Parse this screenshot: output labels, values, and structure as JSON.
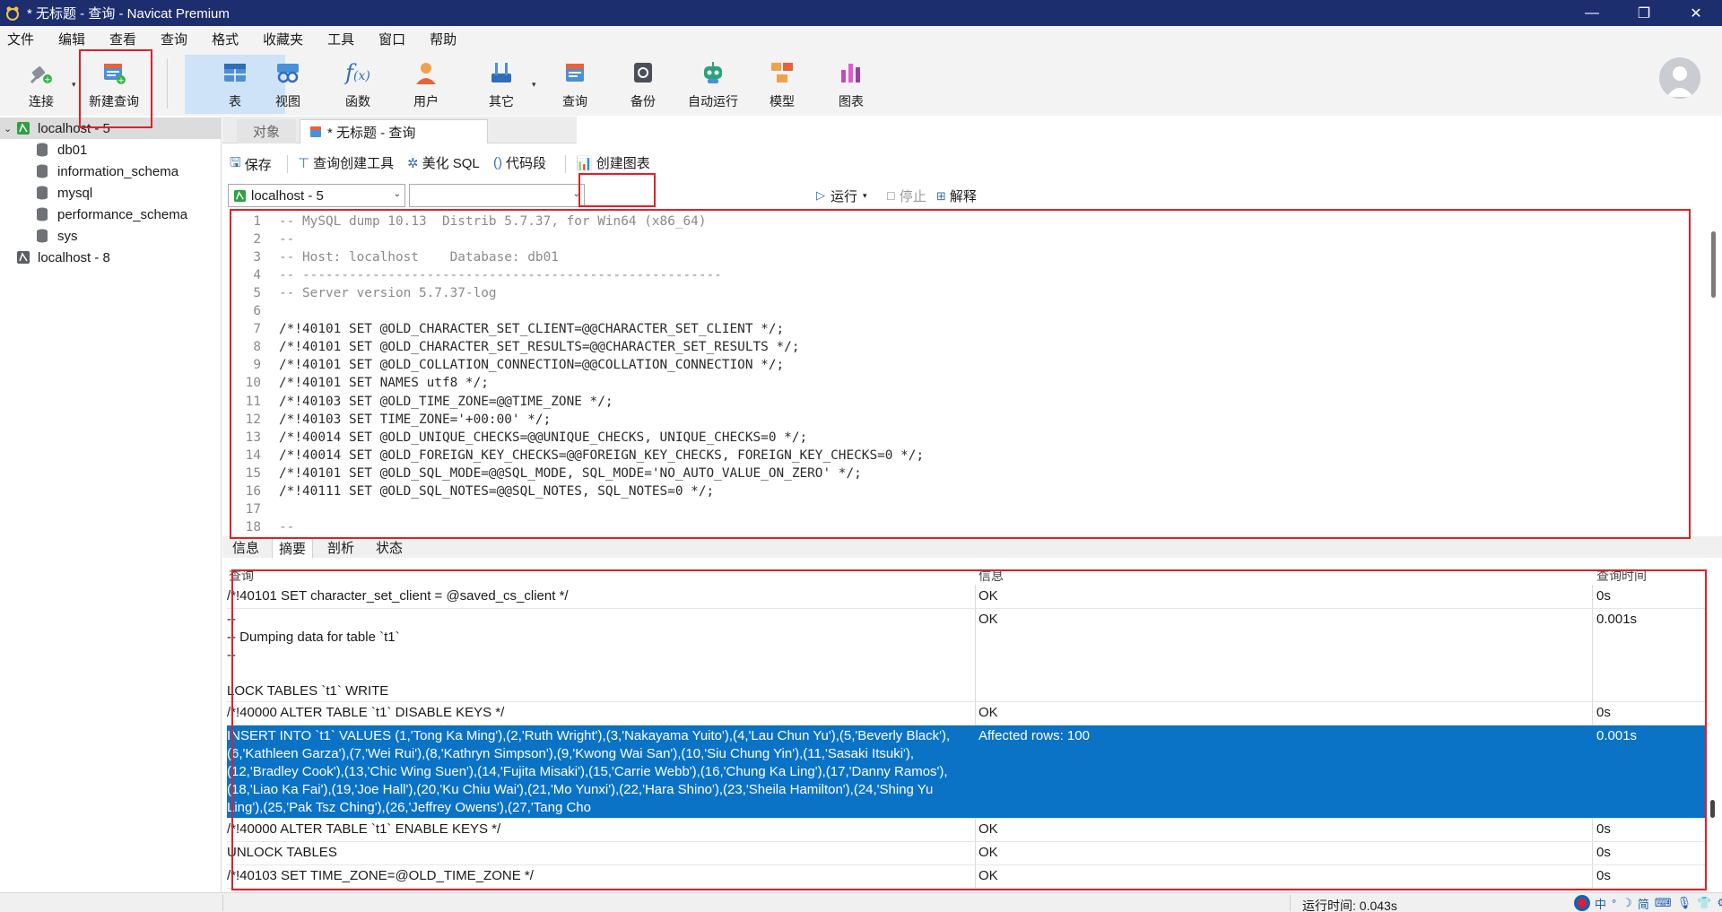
{
  "window": {
    "title": "* 无标题 - 查询 - Navicat Premium",
    "buttons": [
      "—",
      "❐",
      "✕"
    ]
  },
  "menu": [
    "文件",
    "编辑",
    "查看",
    "查询",
    "格式",
    "收藏夹",
    "工具",
    "窗口",
    "帮助"
  ],
  "toolbar": {
    "connect": "连接",
    "new_query": "新建查询",
    "table": "表",
    "view": "视图",
    "function": "函数",
    "user": "用户",
    "other": "其它",
    "query": "查询",
    "backup": "备份",
    "automation": "自动运行",
    "model": "模型",
    "chart": "图表"
  },
  "sidebar": {
    "connections": [
      {
        "name": "localhost - 5",
        "expanded": true,
        "databases": [
          "db01",
          "information_schema",
          "mysql",
          "performance_schema",
          "sys"
        ]
      },
      {
        "name": "localhost - 8",
        "expanded": false
      }
    ]
  },
  "tabs": {
    "objects": "对象",
    "query": "* 无标题 - 查询"
  },
  "query_toolbar": {
    "save": "保存",
    "builder": "查询创建工具",
    "beautify": "美化 SQL",
    "snippet": "代码段",
    "create_chart": "创建图表",
    "connection_select": "localhost - 5",
    "database_select": "",
    "run": "运行",
    "stop": "停止",
    "explain": "解释"
  },
  "editor": {
    "lines": [
      {
        "n": "1",
        "text": "-- MySQL dump 10.13  Distrib 5.7.37, for Win64 (x86_64)",
        "comment": true
      },
      {
        "n": "2",
        "text": "--",
        "comment": true
      },
      {
        "n": "3",
        "text": "-- Host: localhost    Database: db01",
        "comment": true
      },
      {
        "n": "4",
        "text": "-- ------------------------------------------------------",
        "comment": true
      },
      {
        "n": "5",
        "text": "-- Server version 5.7.37-log",
        "comment": true
      },
      {
        "n": "6",
        "text": "",
        "comment": false
      },
      {
        "n": "7",
        "text": "/*!40101 SET @OLD_CHARACTER_SET_CLIENT=@@CHARACTER_SET_CLIENT */;",
        "comment": false
      },
      {
        "n": "8",
        "text": "/*!40101 SET @OLD_CHARACTER_SET_RESULTS=@@CHARACTER_SET_RESULTS */;",
        "comment": false
      },
      {
        "n": "9",
        "text": "/*!40101 SET @OLD_COLLATION_CONNECTION=@@COLLATION_CONNECTION */;",
        "comment": false
      },
      {
        "n": "10",
        "text": "/*!40101 SET NAMES utf8 */;",
        "comment": false
      },
      {
        "n": "11",
        "text": "/*!40103 SET @OLD_TIME_ZONE=@@TIME_ZONE */;",
        "comment": false
      },
      {
        "n": "12",
        "text": "/*!40103 SET TIME_ZONE='+00:00' */;",
        "comment": false
      },
      {
        "n": "13",
        "text": "/*!40014 SET @OLD_UNIQUE_CHECKS=@@UNIQUE_CHECKS, UNIQUE_CHECKS=0 */;",
        "comment": false
      },
      {
        "n": "14",
        "text": "/*!40014 SET @OLD_FOREIGN_KEY_CHECKS=@@FOREIGN_KEY_CHECKS, FOREIGN_KEY_CHECKS=0 */;",
        "comment": false
      },
      {
        "n": "15",
        "text": "/*!40101 SET @OLD_SQL_MODE=@@SQL_MODE, SQL_MODE='NO_AUTO_VALUE_ON_ZERO' */;",
        "comment": false
      },
      {
        "n": "16",
        "text": "/*!40111 SET @OLD_SQL_NOTES=@@SQL_NOTES, SQL_NOTES=0 */;",
        "comment": false
      },
      {
        "n": "17",
        "text": "",
        "comment": false
      },
      {
        "n": "18",
        "text": "--",
        "comment": true
      }
    ]
  },
  "result_tabs": [
    "信息",
    "摘要",
    "剖析",
    "状态"
  ],
  "results": {
    "headers": [
      "查询",
      "信息",
      "查询时间"
    ],
    "rows": [
      {
        "query": "/*!40101 SET character_set_client = @saved_cs_client */",
        "info": "OK",
        "time": "0s"
      },
      {
        "query": "--\n-- Dumping data for table `t1`\n--\n\nLOCK TABLES `t1` WRITE",
        "info": "OK",
        "time": "0.001s"
      },
      {
        "query": "/*!40000 ALTER TABLE `t1` DISABLE KEYS */",
        "info": "OK",
        "time": "0s"
      },
      {
        "query": "INSERT INTO `t1` VALUES (1,'Tong Ka Ming'),(2,'Ruth Wright'),(3,'Nakayama Yuito'),(4,'Lau Chun Yu'),(5,'Beverly Black'),(6,'Kathleen Garza'),(7,'Wei Rui'),(8,'Kathryn Simpson'),(9,'Kwong Wai San'),(10,'Siu Chung Yin'),(11,'Sasaki Itsuki'),(12,'Bradley Cook'),(13,'Chic Wing Suen'),(14,'Fujita Misaki'),(15,'Carrie Webb'),(16,'Chung Ka Ling'),(17,'Danny Ramos'),(18,'Liao Ka Fai'),(19,'Joe Hall'),(20,'Ku Chiu Wai'),(21,'Mo Yunxi'),(22,'Hara Shino'),(23,'Sheila Hamilton'),(24,'Shing Yu Ling'),(25,'Pak Tsz Ching'),(26,'Jeffrey Owens'),(27,'Tang Cho",
        "info": "Affected rows: 100",
        "time": "0.001s",
        "selected": true
      },
      {
        "query": "/*!40000 ALTER TABLE `t1` ENABLE KEYS */",
        "info": "OK",
        "time": "0s"
      },
      {
        "query": "UNLOCK TABLES",
        "info": "OK",
        "time": "0s"
      },
      {
        "query": "/*!40103 SET TIME_ZONE=@OLD_TIME_ZONE */",
        "info": "OK",
        "time": "0s"
      }
    ]
  },
  "status": {
    "runtime": "运行时间: 0.043s"
  },
  "tray": [
    "中",
    "°",
    "☽",
    "简",
    "⚙"
  ],
  "colors": {
    "titlebar": "#1c2e6e",
    "selection": "#0a73c6",
    "annotation": "#e0202a"
  }
}
